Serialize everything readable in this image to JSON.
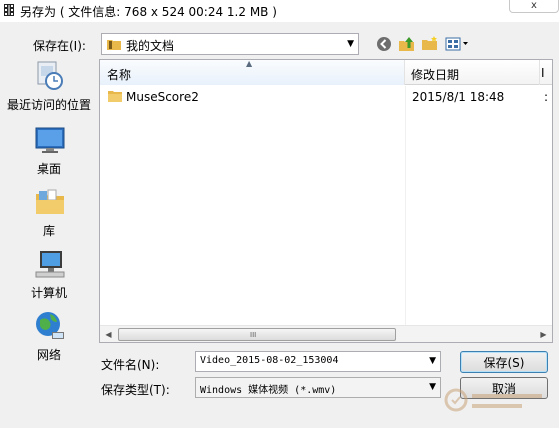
{
  "window": {
    "title": "另存为 ( 文件信息: 768 x 524     00:24     1.2 MB )",
    "close_glyph": "x"
  },
  "toolbar": {
    "save_in_label": "保存在(I):",
    "location": "我的文档",
    "icons": [
      "back-icon",
      "up-folder-icon",
      "new-folder-icon",
      "view-menu-icon"
    ]
  },
  "places": [
    {
      "label": "最近访问的位置",
      "icon": "recent-places-icon"
    },
    {
      "label": "桌面",
      "icon": "desktop-icon"
    },
    {
      "label": "库",
      "icon": "libraries-icon"
    },
    {
      "label": "计算机",
      "icon": "computer-icon"
    },
    {
      "label": "网络",
      "icon": "network-icon"
    }
  ],
  "filelist": {
    "columns": [
      "名称",
      "修改日期",
      "I"
    ],
    "rows": [
      {
        "name": "MuseScore2",
        "date": "2015/8/1 18:48",
        "more": ":"
      }
    ],
    "scroll_grip": "III"
  },
  "form": {
    "filename_label": "文件名(N):",
    "filename_value": "Video_2015-08-02_153004",
    "filetype_label": "保存类型(T):",
    "filetype_value": "Windows 媒体视频 (*.wmv)"
  },
  "buttons": {
    "save": "保存(S)",
    "cancel": "取消"
  },
  "colors": {
    "folder": "#e8b84a",
    "selection_header": "#e8f1fb",
    "primary_border": "#3c7fb1"
  }
}
